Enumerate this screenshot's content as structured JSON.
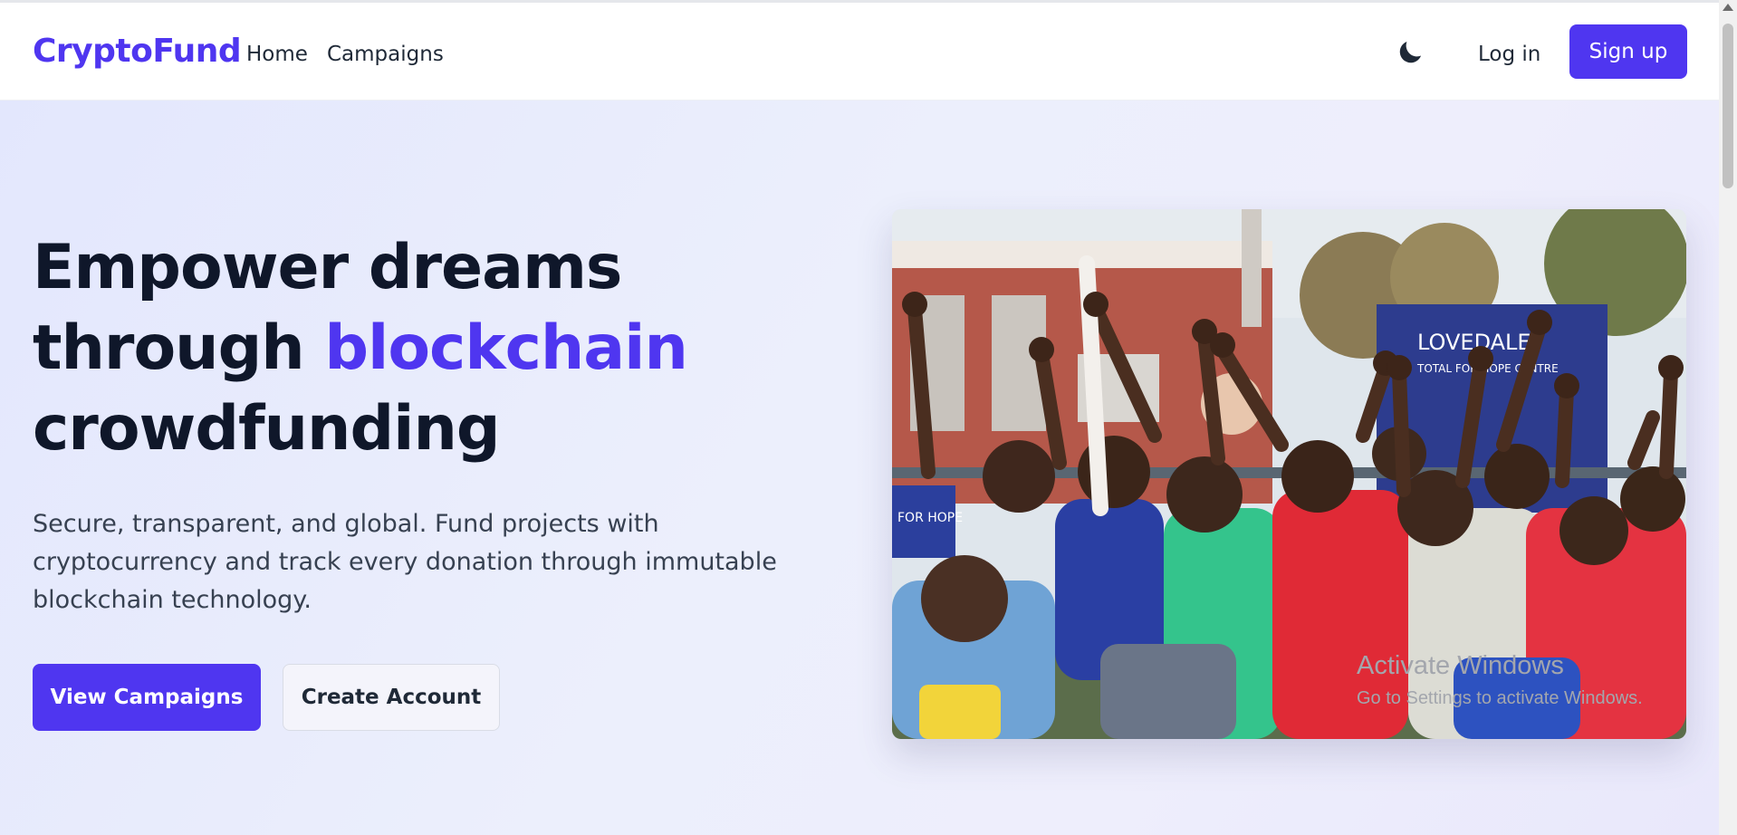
{
  "nav": {
    "brand": "CryptoFund",
    "links": [
      "Home",
      "Campaigns"
    ],
    "theme_toggle_icon": "moon-icon",
    "login_label": "Log in",
    "signup_label": "Sign up"
  },
  "hero": {
    "headline_part1": "Empower dreams",
    "headline_part2": "through ",
    "headline_accent": "blockchain",
    "headline_part3": "crowdfunding",
    "subtext": "Secure, transparent, and global. Fund projects with cryptocurrency and track every donation through immutable blockchain technology.",
    "primary_button": "View Campaigns",
    "secondary_button": "Create Account",
    "image_sign_line1": "LOVEDALE",
    "image_sign_line2": "TOTAL FOR HOPE CENTRE",
    "image_sign_left": "FOR HOPE"
  },
  "watermark": {
    "title": "Activate Windows",
    "subtitle": "Go to Settings to activate Windows."
  },
  "colors": {
    "accent": "#4f36f0",
    "text_dark": "#0f172a",
    "hero_bg": "#e9ebfc"
  }
}
